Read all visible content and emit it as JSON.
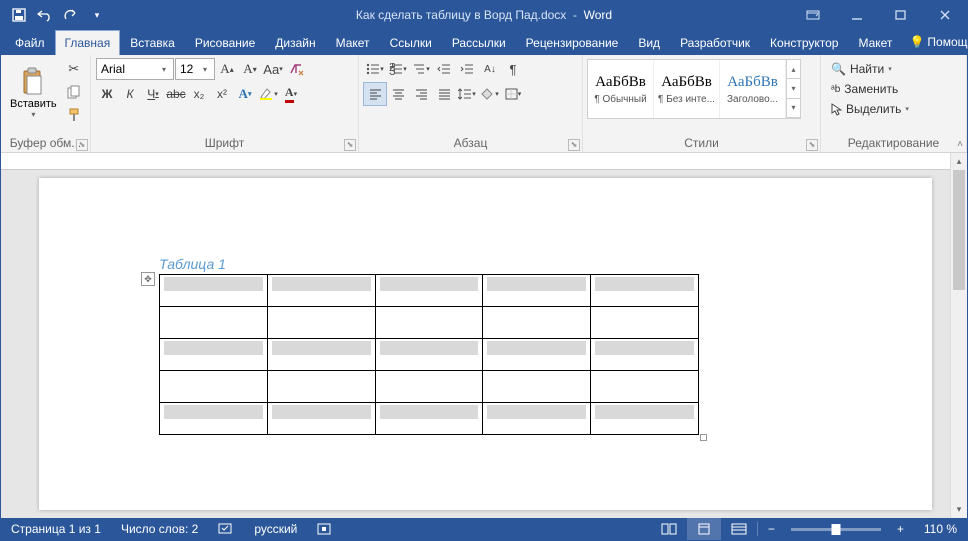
{
  "titlebar": {
    "doc": "Как сделать таблицу в Ворд Пад.docx",
    "app": "Word"
  },
  "tabs": [
    "Файл",
    "Главная",
    "Вставка",
    "Рисование",
    "Дизайн",
    "Макет",
    "Ссылки",
    "Рассылки",
    "Рецензирование",
    "Вид",
    "Разработчик",
    "Конструктор",
    "Макет"
  ],
  "help_label": "Помощн",
  "clipboard": {
    "paste": "Вставить",
    "group": "Буфер обм..."
  },
  "font": {
    "name": "Arial",
    "size": "12",
    "group": "Шрифт",
    "bold": "Ж",
    "italic": "К",
    "underline": "Ч",
    "strike": "abc",
    "sub": "x₂",
    "sup": "x²"
  },
  "para": {
    "group": "Абзац"
  },
  "styles": {
    "group": "Стили",
    "items": [
      {
        "preview": "АаБбВв",
        "name": "¶ Обычный"
      },
      {
        "preview": "АаБбВв",
        "name": "¶ Без инте..."
      },
      {
        "preview": "АаБбВв",
        "name": "Заголово..."
      }
    ]
  },
  "editing": {
    "group": "Редактирование",
    "find": "Найти",
    "replace": "Заменить",
    "select": "Выделить"
  },
  "document": {
    "caption": "Таблица 1"
  },
  "status": {
    "page": "Страница 1 из 1",
    "words": "Число слов: 2",
    "lang": "русский",
    "zoom": "110 %"
  }
}
